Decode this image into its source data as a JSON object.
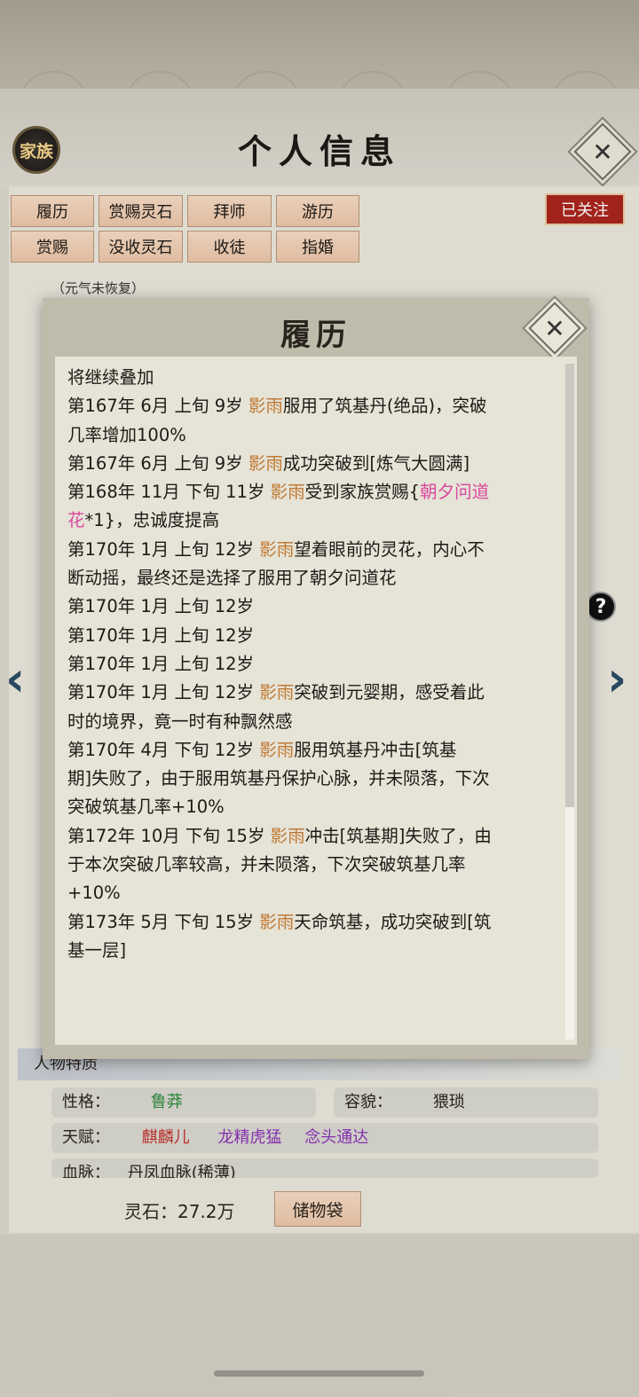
{
  "header": {
    "title": "个人信息",
    "family_button": "家族",
    "close_icon": "close-icon"
  },
  "tabs": [
    {
      "label": "履历"
    },
    {
      "label": "赏赐灵石"
    },
    {
      "label": "拜师"
    },
    {
      "label": "游历"
    },
    {
      "label": "赏赐"
    },
    {
      "label": "没收灵石"
    },
    {
      "label": "收徒"
    },
    {
      "label": "指婚"
    }
  ],
  "follow_button": "已关注",
  "status_tag": "（元气未恢复）",
  "traits": {
    "section_title": "人物特质",
    "personality_label": "性格：",
    "personality_value": "鲁莽",
    "appearance_label": "容貌：",
    "appearance_value": "猥琐",
    "talent_label": "天赋：",
    "talents": [
      "麒麟儿",
      "龙精虎猛",
      "念头通达"
    ],
    "bloodline_label": "血脉：",
    "bloodline_value": "丹凤血脉(稀薄)"
  },
  "footer": {
    "spirit_stone": "灵石：27.2万",
    "bag_button": "储物袋"
  },
  "modal": {
    "title": "履历",
    "lines": [
      [
        {
          "t": "将继续叠加"
        }
      ],
      [
        {
          "t": "第167年 6月 上旬  9岁 "
        },
        {
          "t": "影雨",
          "c": "gold"
        },
        {
          "t": "服用了筑基丹(绝品)，突破"
        }
      ],
      [
        {
          "t": "几率增加100%"
        }
      ],
      [
        {
          "t": "第167年 6月  上旬   9岁  "
        },
        {
          "t": "影雨",
          "c": "gold"
        },
        {
          "t": "成功突破到[炼气大圆满]"
        }
      ],
      [
        {
          "t": "第168年 11月 下旬  11岁  "
        },
        {
          "t": "影雨",
          "c": "gold"
        },
        {
          "t": "受到家族赏赐{"
        },
        {
          "t": "朝夕问道",
          "c": "pink"
        }
      ],
      [
        {
          "t": "花",
          "c": "pink"
        },
        {
          "t": "*1}，忠诚度提高"
        }
      ],
      [
        {
          "t": "第170年 1月 上旬  12岁  "
        },
        {
          "t": "影雨",
          "c": "gold"
        },
        {
          "t": "望着眼前的灵花，内心不"
        }
      ],
      [
        {
          "t": "断动摇，最终还是选择了服用了朝夕问道花"
        }
      ],
      [
        {
          "t": "第170年  1月  上旬   12岁"
        }
      ],
      [
        {
          "t": "第170年  1月  上旬   12岁"
        }
      ],
      [
        {
          "t": "第170年  1月  上旬   12岁"
        }
      ],
      [
        {
          "t": "第170年 1月 上旬  12岁  "
        },
        {
          "t": "影雨",
          "c": "gold"
        },
        {
          "t": "突破到元婴期，感受着此"
        }
      ],
      [
        {
          "t": "时的境界，竟一时有种飘然感"
        }
      ],
      [
        {
          "t": "第170年   4月   下旬     12岁    "
        },
        {
          "t": "影雨",
          "c": "gold"
        },
        {
          "t": "服用筑基丹冲击[筑基"
        }
      ],
      [
        {
          "t": "期]失败了，由于服用筑基丹保护心脉，并未陨落，下次"
        }
      ],
      [
        {
          "t": "突破筑基几率+10%"
        }
      ],
      [
        {
          "t": "第172年 10月 下旬  15岁  "
        },
        {
          "t": "影雨",
          "c": "gold"
        },
        {
          "t": "冲击[筑基期]失败了，由"
        }
      ],
      [
        {
          "t": "于本次突破几率较高，并未陨落，下次突破筑基几率"
        }
      ],
      [
        {
          "t": "+10%"
        }
      ],
      [
        {
          "t": "第173年 5月 下旬  15岁  "
        },
        {
          "t": "影雨",
          "c": "gold"
        },
        {
          "t": "天命筑基，成功突破到[筑"
        }
      ],
      [
        {
          "t": "基一层]"
        }
      ]
    ]
  },
  "colors": {
    "gold": "#c07a34",
    "pink": "#d9479d",
    "follow": "#a8251d"
  }
}
